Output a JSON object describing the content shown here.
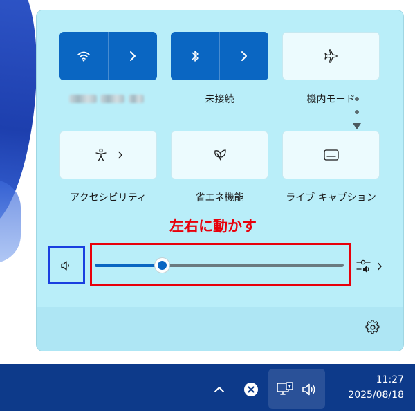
{
  "tiles": {
    "wifi": {
      "state": "on"
    },
    "bluetooth": {
      "label": "未接続",
      "state": "on"
    },
    "airplane": {
      "label": "機内モード",
      "state": "off"
    },
    "accessibility": {
      "label": "アクセシビリティ",
      "state": "off"
    },
    "energy_saver": {
      "label": "省エネ機能",
      "state": "off"
    },
    "live_captions": {
      "label": "ライブ キャプション",
      "state": "off"
    }
  },
  "annotation": {
    "text": "左右に動かす",
    "color_text": "#e8000b",
    "color_blue_box": "#1a3fe0",
    "color_red_box": "#e8000b"
  },
  "volume": {
    "level_percent": 27,
    "accent": "#0a66c2"
  },
  "icons": {
    "wifi": "wifi-icon",
    "bluetooth": "bluetooth-icon",
    "airplane": "airplane-icon",
    "accessibility": "accessibility-icon",
    "energy_saver": "leaf-icon",
    "live_captions": "captions-icon",
    "speaker": "speaker-icon",
    "audio_output": "audio-output-icon",
    "settings": "gear-icon"
  },
  "taskbar": {
    "time": "11:27",
    "date": "2025/08/18"
  },
  "colors": {
    "panel_bg": "#bdf0fb",
    "tile_on": "#0a66c2",
    "taskbar": "#0d3a8a"
  }
}
